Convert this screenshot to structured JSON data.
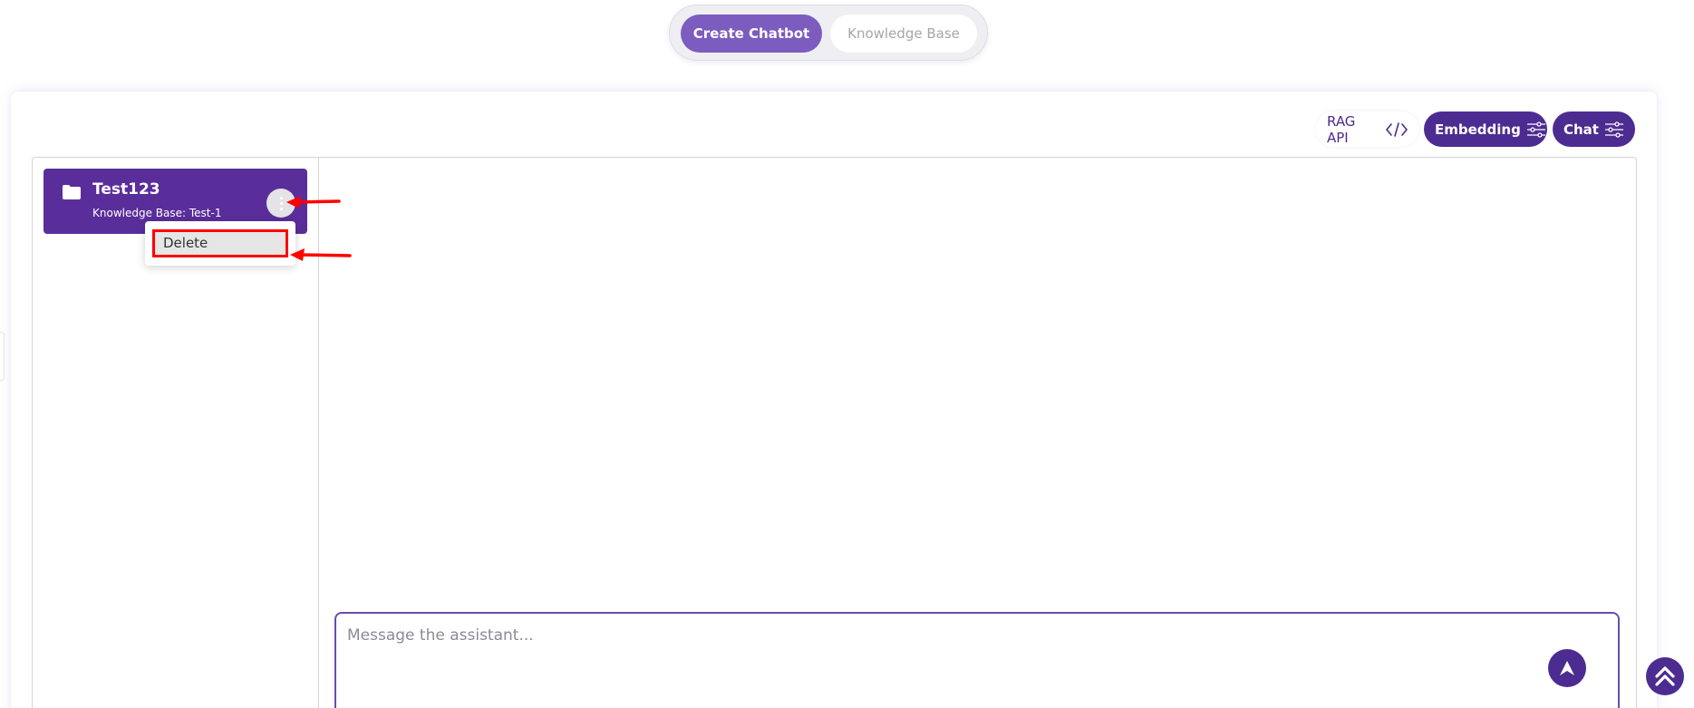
{
  "top_tabs": {
    "create_chatbot": "Create Chatbot",
    "knowledge_base": "Knowledge Base"
  },
  "toolbar": {
    "rag_api": "RAG API",
    "embedding": "Embedding",
    "chat": "Chat"
  },
  "chatbot_card": {
    "name": "Test123",
    "knowledge_base": "Knowledge Base: Test-1"
  },
  "context_menu": {
    "delete": "Delete"
  },
  "composer": {
    "placeholder": "Message the assistant..."
  },
  "colors": {
    "primary": "#4d2c91",
    "accent": "#7c5cbf",
    "annotation": "#ff0000"
  }
}
